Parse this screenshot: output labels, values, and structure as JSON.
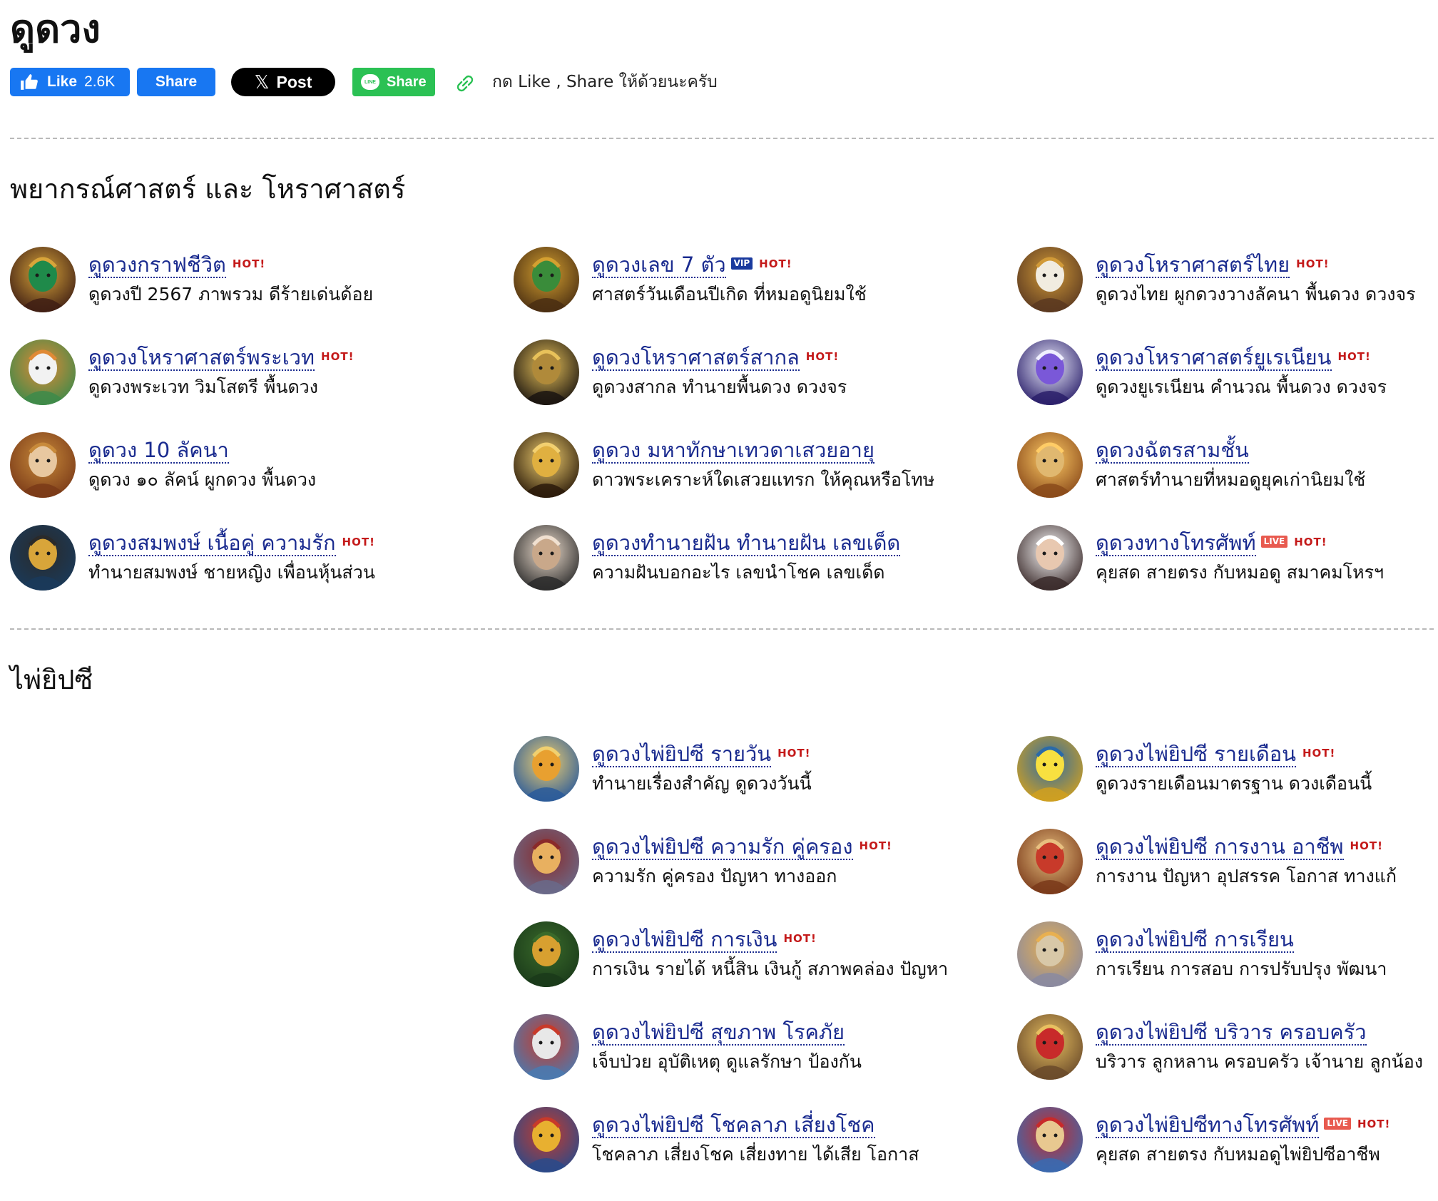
{
  "page": {
    "title": "ดูดวง"
  },
  "share_bar": {
    "fb_like_label": "Like",
    "fb_like_count": "2.6K",
    "fb_share_label": "Share",
    "x_post_label": "Post",
    "line_share_label": "Share",
    "line_icon_text": "LINE",
    "note": "กด Like , Share ให้ด้วยนะครับ"
  },
  "colors": {
    "link": "#1a2b8f",
    "hot": "#c41a1a",
    "facebook": "#1877f2",
    "line": "#2bc154",
    "vip_badge": "#1a3a9e",
    "live_badge": "#e85a4f"
  },
  "sections": [
    {
      "title": "พยากรณ์ศาสตร์ และ โหราศาสตร์",
      "items": [
        {
          "title": "ดูดวงกราฟชีวิต",
          "hot": "HOT!",
          "desc": "ดูดวงปี 2567 ภาพรวม ดีร้ายเด่นด้อย"
        },
        {
          "title": "ดูดวงเลข 7 ตัว",
          "vip": "VIP",
          "hot": "HOT!",
          "desc": "ศาสตร์วันเดือนปีเกิด ที่หมอดูนิยมใช้"
        },
        {
          "title": "ดูดวงโหราศาสตร์ไทย",
          "hot": "HOT!",
          "desc": "ดูดวงไทย ผูกดวงวางลัคนา พื้นดวง ดวงจร"
        },
        {
          "title": "ดูดวงโหราศาสตร์พระเวท",
          "hot": "HOT!",
          "desc": "ดูดวงพระเวท วิมโสตรี พื้นดวง"
        },
        {
          "title": "ดูดวงโหราศาสตร์สากล",
          "hot": "HOT!",
          "desc": "ดูดวงสากล ทำนายพื้นดวง ดวงจร"
        },
        {
          "title": "ดูดวงโหราศาสตร์ยูเรเนียน",
          "hot": "HOT!",
          "desc": "ดูดวงยูเรเนียน คำนวณ พื้นดวง ดวงจร"
        },
        {
          "title": "ดูดวง 10 ลัคนา",
          "desc": "ดูดวง ๑๐ ลัคน์ ผูกดวง พื้นดวง"
        },
        {
          "title": "ดูดวง มหาทักษาเทวดาเสวยอายุ",
          "desc": "ดาวพระเคราะห์ใดเสวยแทรก ให้คุณหรือโทษ"
        },
        {
          "title": "ดูดวงฉัตรสามชั้น",
          "desc": "ศาสตร์ทำนายที่หมอดูยุคเก่านิยมใช้"
        },
        {
          "title": "ดูดวงสมพงษ์ เนื้อคู่ ความรัก",
          "hot": "HOT!",
          "desc": "ทำนายสมพงษ์ ชายหญิง เพื่อนหุ้นส่วน"
        },
        {
          "title": "ดูดวงทำนายฝัน ทำนายฝัน เลขเด็ด",
          "desc": "ความฝันบอกอะไร เลขนำโชค เลขเด็ด"
        },
        {
          "title": "ดูดวงทางโทรศัพท์",
          "live": "LIVE",
          "hot": "HOT!",
          "desc": "คุยสด สายตรง กับหมอดู สมาคมโหรฯ"
        }
      ]
    },
    {
      "title": "ไพ่ยิปซี",
      "items": [
        {
          "title": "ดูดวงไพ่ยิปซี รายวัน",
          "hot": "HOT!",
          "desc": "ทำนายเรื่องสำคัญ ดูดวงวันนี้"
        },
        {
          "title": "ดูดวงไพ่ยิปซี รายเดือน",
          "hot": "HOT!",
          "desc": "ดูดวงรายเดือนมาตรฐาน ดวงเดือนนี้"
        },
        {
          "title": "ดูดวงไพ่ยิปซี ความรัก คู่ครอง",
          "hot": "HOT!",
          "desc": "ความรัก คู่ครอง ปัญหา ทางออก"
        },
        {
          "title": "ดูดวงไพ่ยิปซี การงาน อาชีพ",
          "hot": "HOT!",
          "desc": "การงาน ปัญหา อุปสรรค โอกาส ทางแก้"
        },
        {
          "title": "ดูดวงไพ่ยิปซี การเงิน",
          "hot": "HOT!",
          "desc": "การเงิน รายได้ หนี้สิน เงินกู้ สภาพคล่อง ปัญหา"
        },
        {
          "title": "ดูดวงไพ่ยิปซี การเรียน",
          "desc": "การเรียน การสอบ การปรับปรุง พัฒนา"
        },
        {
          "title": "ดูดวงไพ่ยิปซี สุขภาพ โรคภัย",
          "desc": "เจ็บป่วย อุบัติเหตุ ดูแลรักษา ป้องกัน"
        },
        {
          "title": "ดูดวงไพ่ยิปซี บริวาร ครอบครัว",
          "desc": "บริวาร ลูกหลาน ครอบครัว เจ้านาย ลูกน้อง"
        },
        {
          "title": "ดูดวงไพ่ยิปซี โชคลาภ เสี่ยงโชค",
          "desc": "โชคลาภ เสี่ยงโชค เสี่ยงทาย ได้เสีย โอกาส"
        },
        {
          "title": "ดูดวงไพ่ยิปซีทางโทรศัพท์",
          "live": "LIVE",
          "hot": "HOT!",
          "desc": "คุยสด สายตรง กับหมอดูไพ่ยิปซีอาชีพ"
        }
      ]
    }
  ]
}
